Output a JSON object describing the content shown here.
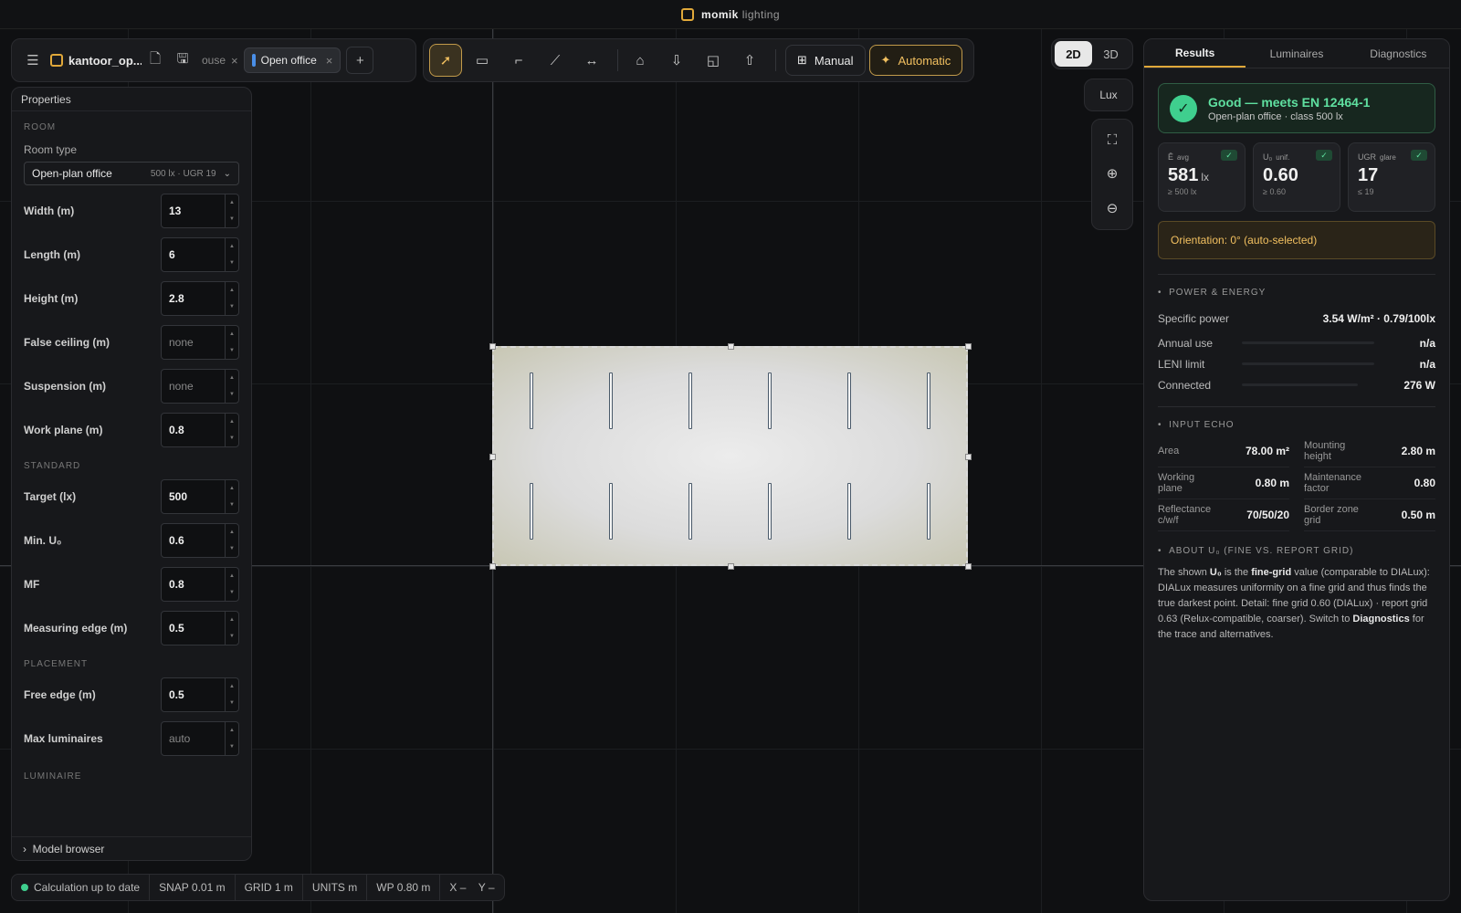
{
  "app": {
    "brand": "momik",
    "brand_sub": "lighting"
  },
  "file": {
    "project_name": "kantoor_op...",
    "tabs": [
      {
        "label": "ouse"
      },
      {
        "label": "Open office",
        "active": true
      }
    ]
  },
  "toolbar": {
    "manual_label": "Manual",
    "automatic_label": "Automatic",
    "active_mode": "Automatic"
  },
  "view": {
    "mode_2d": "2D",
    "mode_3d": "3D",
    "active": "2D",
    "lux_label": "Lux"
  },
  "properties": {
    "title": "Properties",
    "room_section": "ROOM",
    "room_type_label": "Room type",
    "room_type_value": "Open-plan office",
    "room_type_hint": "500 lx · UGR 19",
    "room_fields": [
      {
        "label": "Width (m)",
        "value": "13"
      },
      {
        "label": "Length (m)",
        "value": "6"
      },
      {
        "label": "Height (m)",
        "value": "2.8"
      },
      {
        "label": "False ceiling (m)",
        "placeholder": "none"
      },
      {
        "label": "Suspension (m)",
        "placeholder": "none"
      },
      {
        "label": "Work plane (m)",
        "value": "0.8"
      }
    ],
    "standard_section": "STANDARD",
    "standard_fields": [
      {
        "label": "Target (lx)",
        "value": "500"
      },
      {
        "label": "Min. U₀",
        "value": "0.6"
      },
      {
        "label": "MF",
        "value": "0.8"
      },
      {
        "label": "Measuring edge (m)",
        "value": "0.5"
      }
    ],
    "placement_section": "PLACEMENT",
    "placement_fields": [
      {
        "label": "Free edge (m)",
        "value": "0.5"
      },
      {
        "label": "Max luminaires",
        "placeholder": "auto"
      }
    ],
    "luminaire_section": "LUMINAIRE",
    "model_browser": "Model browser"
  },
  "status": {
    "calc": "Calculation up to date",
    "snap": "SNAP 0.01 m",
    "grid": "GRID 1 m",
    "units": "UNITS m",
    "wp": "WP 0.80 m",
    "x": "X –",
    "y": "Y –"
  },
  "room_plan": {
    "luminaire_rows": 2,
    "luminaires_per_row": 6
  },
  "results": {
    "tabs": [
      "Results",
      "Luminaires",
      "Diagnostics"
    ],
    "active_tab": "Results",
    "verdict_title": "Good — meets EN 12464-1",
    "verdict_sub": "Open-plan office · class 500 lx",
    "metrics": [
      {
        "label": "Ē",
        "sub": "avg",
        "value": "581",
        "unit": "lx",
        "req": "≥ 500 lx"
      },
      {
        "label": "U₀",
        "sub": "unif.",
        "value": "0.60",
        "unit": "",
        "req": "≥ 0.60"
      },
      {
        "label": "UGR",
        "sub": "glare",
        "value": "17",
        "unit": "",
        "req": "≤ 19"
      }
    ],
    "orientation": "Orientation: 0° (auto-selected)",
    "power_heading": "POWER & ENERGY",
    "specific_power_label": "Specific power",
    "specific_power_value": "3.54 W/m² · 0.79/100lx",
    "energy_rows": [
      {
        "label": "Annual use",
        "value": "n/a"
      },
      {
        "label": "LENI limit",
        "value": "n/a"
      },
      {
        "label": "Connected",
        "value": "276 W"
      }
    ],
    "echo_heading": "INPUT ECHO",
    "echo": [
      {
        "label": "Area",
        "value": "78.00 m²"
      },
      {
        "label": "Mounting height",
        "value": "2.80 m"
      },
      {
        "label": "Working plane",
        "value": "0.80 m"
      },
      {
        "label": "Maintenance factor",
        "value": "0.80"
      },
      {
        "label": "Reflectance c/w/f",
        "value": "70/50/20"
      },
      {
        "label": "Border zone grid",
        "value": "0.50 m"
      }
    ],
    "about_heading": "ABOUT U₀ (FINE VS. REPORT GRID)",
    "about": {
      "t1": "The shown ",
      "b1": "U₀",
      "t2": " is the ",
      "b2": "fine-grid",
      "t3": " value (comparable to DIALux): DIALux measures uniformity on a fine grid and thus finds the true darkest point. Detail: fine grid 0.60 (DIALux) · report grid 0.63 (Relux-compatible, coarser). Switch to ",
      "b3": "Diagnostics",
      "t4": " for the trace and alternatives."
    }
  }
}
